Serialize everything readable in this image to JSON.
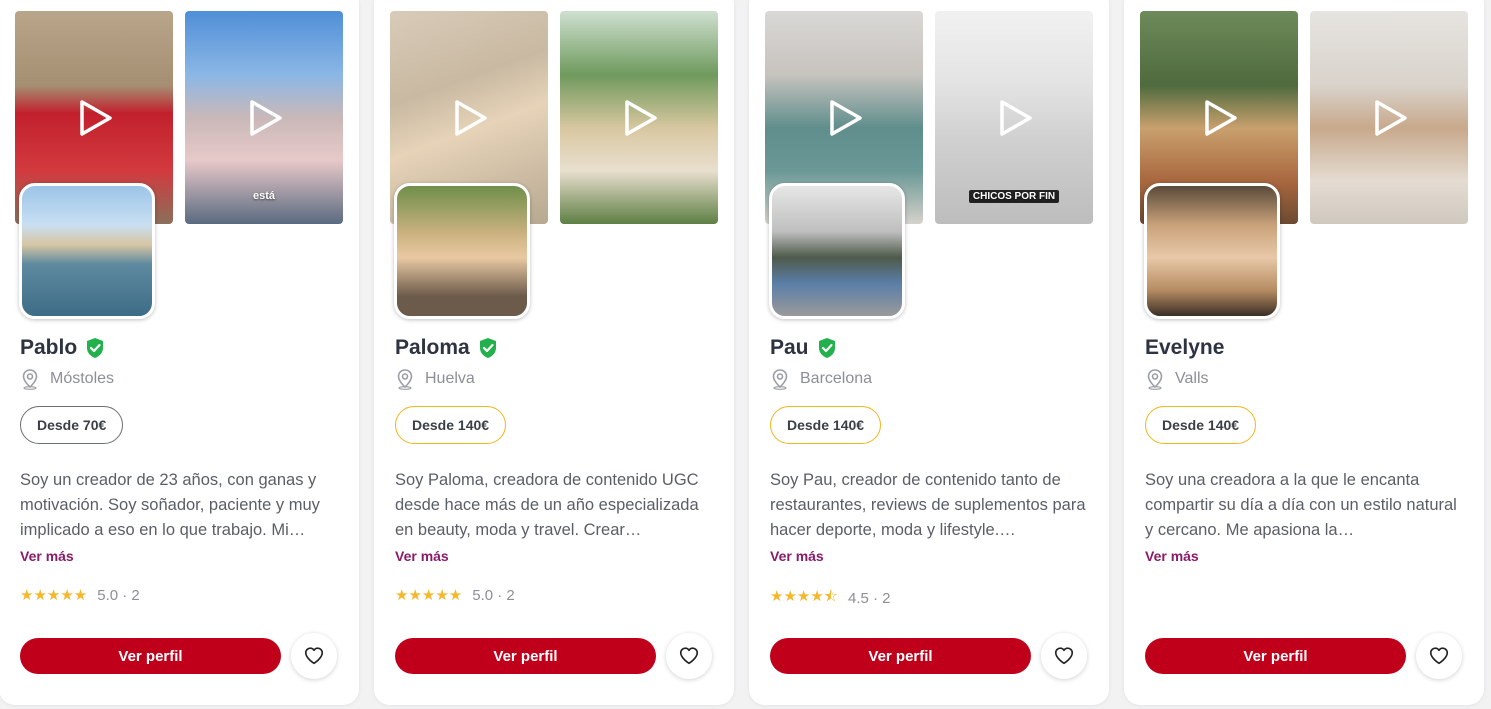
{
  "colors": {
    "primary_button": "#c0001a",
    "link": "#8a1b6a",
    "verified": "#22b14c",
    "star": "#f4b82a",
    "price_border_default": "#6b6f76",
    "price_border_gold": "#f2b61f"
  },
  "cards": [
    {
      "name": "Pablo",
      "verified": true,
      "location": "Móstoles",
      "price": "Desde 70€",
      "description": "Soy un creador de 23 años, con ganas y motivación. Soy soñador, paciente y muy implicado a eso en lo que trabajo. Mi…",
      "more_label": "Ver más",
      "stars": "★★★★★",
      "rating_text": "5.0 · 2",
      "button_label": "Ver perfil",
      "video_captions": [
        "",
        "está"
      ]
    },
    {
      "name": "Paloma",
      "verified": true,
      "location": "Huelva",
      "price": "Desde 140€",
      "description": "Soy Paloma, creadora de contenido UGC desde hace más de un año especializada en beauty, moda y travel. Crear…",
      "more_label": "Ver más",
      "stars": "★★★★★",
      "rating_text": "5.0 · 2",
      "button_label": "Ver perfil",
      "video_captions": [
        "",
        ""
      ]
    },
    {
      "name": "Pau",
      "verified": true,
      "location": "Barcelona",
      "price": "Desde 140€",
      "description": "Soy Pau, creador de contenido tanto de restaurantes, reviews de suplementos para hacer deporte, moda y lifestyle.…",
      "more_label": "Ver más",
      "stars": "★★★★⯪",
      "rating_text": "4.5 · 2",
      "button_label": "Ver perfil",
      "video_captions": [
        "",
        "CHICOS POR FIN"
      ]
    },
    {
      "name": "Evelyne",
      "verified": false,
      "location": "Valls",
      "price": "Desde 140€",
      "description": "Soy una creadora a la que le encanta compartir su día a día con un estilo natural y cercano. Me apasiona la…",
      "more_label": "Ver más",
      "stars": "",
      "rating_text": "",
      "button_label": "Ver perfil",
      "video_captions": [
        "",
        ""
      ]
    }
  ]
}
